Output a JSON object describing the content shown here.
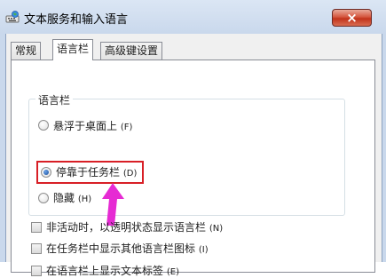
{
  "window": {
    "title": "文本服务和输入语言",
    "close_symbol": "×"
  },
  "tabs": [
    {
      "label": "常规",
      "active": false
    },
    {
      "label": "语言栏",
      "active": true
    },
    {
      "label": "高级键设置",
      "active": false
    }
  ],
  "language_bar_group": {
    "title": "语言栏",
    "options": [
      {
        "label": "悬浮于桌面上",
        "hotkey": "(F)",
        "selected": false
      },
      {
        "label": "停靠于任务栏",
        "hotkey": "(D)",
        "selected": true
      },
      {
        "label": "隐藏",
        "hotkey": "(H)",
        "selected": false
      }
    ]
  },
  "checkboxes": [
    {
      "label": "非活动时，以透明状态显示语言栏",
      "hotkey": "(N)",
      "checked": false
    },
    {
      "label": "在任务栏中显示其他语言栏图标",
      "hotkey": "(I)",
      "checked": false
    },
    {
      "label": "在语言栏上显示文本标签",
      "hotkey": "(E)",
      "checked": false
    }
  ],
  "annotation": {
    "highlight_color": "#d81f26",
    "arrow_color": "#e62bd3"
  },
  "icons": {
    "app": "keyboard-globe-icon",
    "close": "close-icon",
    "arrow": "arrow-up-icon"
  }
}
